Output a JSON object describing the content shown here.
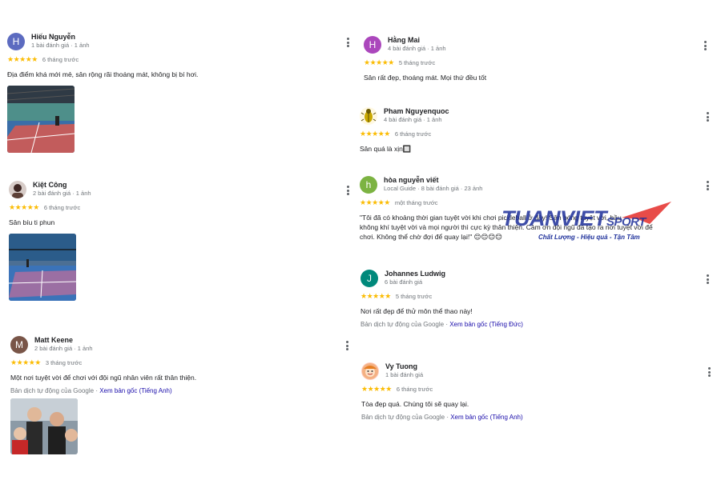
{
  "reviews": {
    "r1": {
      "initial": "H",
      "name": "Hiếu Nguyễn",
      "meta": "1 bài đánh giá · 1 ảnh",
      "stars": "★★★★★",
      "time": "6 tháng trước",
      "text": "Địa điểm khá mới mẻ, sân rộng rãi thoáng mát, không bị bí hơi.",
      "avatar_color": "#5c6bc0"
    },
    "r2": {
      "name": "Kiệt Công",
      "meta": "2 bài đánh giá · 1 ảnh",
      "stars": "★★★★★",
      "time": "6 tháng trước",
      "text": "Sân bíu ti phun"
    },
    "r3": {
      "initial": "M",
      "name": "Matt Keene",
      "meta": "2 bài đánh giá · 1 ảnh",
      "stars": "★★★★★",
      "time": "3 tháng trước",
      "text": "Một nơi tuyệt vời để chơi với đội ngũ nhân viên rất thân thiện.",
      "translated": "Bản dịch tự động của Google · ",
      "original_link": "Xem bản gốc (Tiếng Anh)",
      "avatar_color": "#795548"
    },
    "r4": {
      "initial": "H",
      "name": "Hằng Mai",
      "meta": "4 bài đánh giá · 1 ảnh",
      "stars": "★★★★★",
      "time": "5 tháng trước",
      "text": "Sân rất đẹp, thoáng mát. Mọi thứ đều tốt",
      "avatar_color": "#ab47bc"
    },
    "r5": {
      "name": "Pham Nguyenquoc",
      "meta": "4 bài đánh giá · 1 ảnh",
      "stars": "★★★★★",
      "time": "6 tháng trước",
      "text": "Sân quá là xịn🔲"
    },
    "r6": {
      "initial": "h",
      "name": "hòa nguyễn viết",
      "meta": "Local Guide · 8 bài đánh giá · 23 ảnh",
      "stars": "★★★★★",
      "time": "một tháng trước",
      "text_line1": "\"Tôi đã có khoảng thời gian tuyệt vời khi chơi pickleball ở đây! Sân bóng tuyệt vời, bầu",
      "text_line2": "không khí tuyệt vời và mọi người thì cực kỳ thân thiện. Cảm ơn đội ngũ đã tạo ra nơi tuyệt vời để",
      "text_line3": "chơi. Không thể chờ đợi để quay lại!\" 😊😊😊😊",
      "avatar_color": "#7cb342"
    },
    "r7": {
      "initial": "J",
      "name": "Johannes Ludwig",
      "meta": "6 bài đánh giá",
      "stars": "★★★★★",
      "time": "5 tháng trước",
      "text": "Nơi rất đẹp để thử môn thể thao này!",
      "translated": "Bản dịch tự động của Google · ",
      "original_link": "Xem bản gốc (Tiếng Đức)",
      "avatar_color": "#00897b"
    },
    "r8": {
      "name": "Vy Tuong",
      "meta": "1 bài đánh giá",
      "stars": "★★★★★",
      "time": "6 tháng trước",
      "text": "Tòa đẹp quá. Chúng tôi sẽ quay lại.",
      "translated": "Bản dịch tự động của Google · ",
      "original_link": "Xem bản gốc (Tiếng Anh)"
    }
  },
  "watermark": {
    "brand": "TUANVIET",
    "brand_suffix": "SPORT",
    "tagline": "Chất Lượng - Hiệu quả - Tận Tâm"
  },
  "colors": {
    "star": "#fbbc04",
    "link": "#1a0dab",
    "meta": "#70757a"
  }
}
